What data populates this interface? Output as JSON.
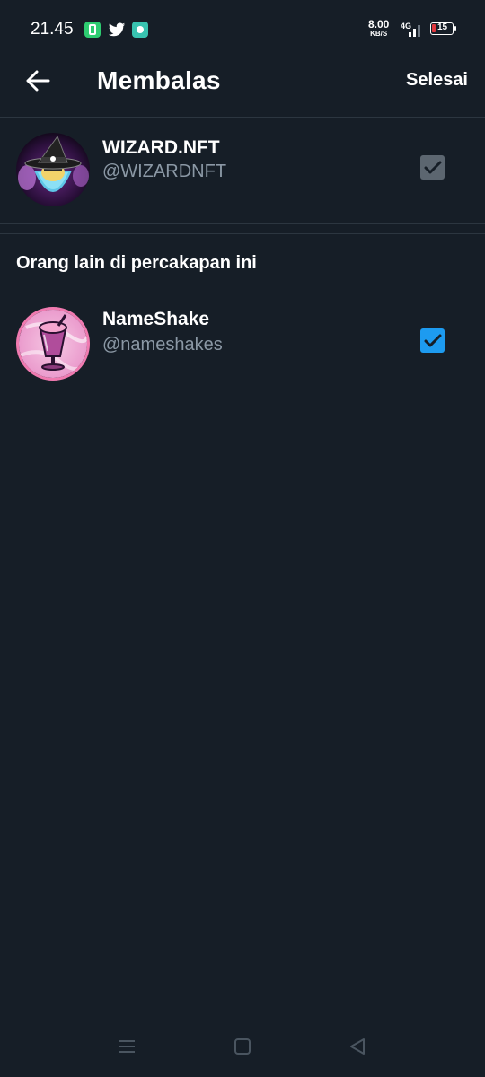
{
  "status_bar": {
    "time": "21.45",
    "net_speed_value": "8.00",
    "net_speed_unit": "KB/S",
    "network": "4G",
    "battery": "15",
    "icons": [
      "phone-app-icon",
      "twitter-icon",
      "teal-app-icon"
    ]
  },
  "app_bar": {
    "title": "Membalas",
    "done_label": "Selesai"
  },
  "primary_user": {
    "name": "WIZARD.NFT",
    "handle": "@WIZARDNFT",
    "checked": true,
    "disabled": true
  },
  "others_section": {
    "title": "Orang lain di percakapan ini",
    "users": [
      {
        "name": "NameShake",
        "handle": "@nameshakes",
        "checked": true
      }
    ]
  },
  "colors": {
    "background": "#161e27",
    "accent": "#1d9bf0",
    "secondary_text": "#8b98a5",
    "disabled_checkbox": "#5c6670"
  }
}
